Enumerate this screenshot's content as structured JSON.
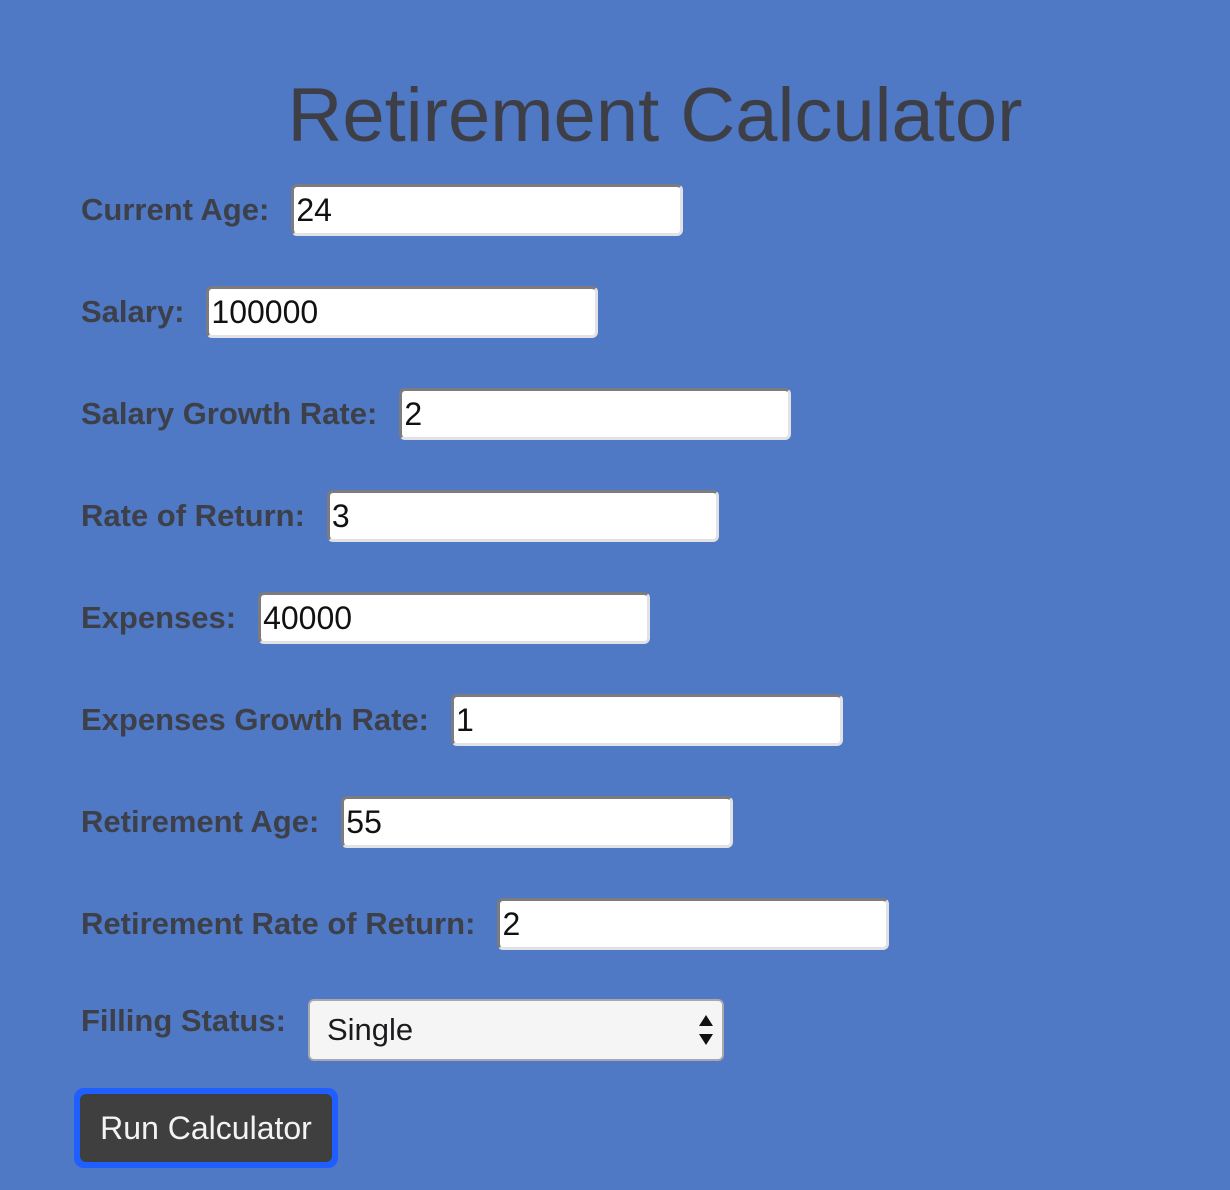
{
  "title": "Retirement Calculator",
  "form": {
    "fields": [
      {
        "label": "Current Age:",
        "value": "24"
      },
      {
        "label": "Salary:",
        "value": "100000"
      },
      {
        "label": "Salary Growth Rate:",
        "value": "2"
      },
      {
        "label": "Rate of Return:",
        "value": "3"
      },
      {
        "label": "Expenses:",
        "value": "40000"
      },
      {
        "label": "Expenses Growth Rate:",
        "value": "1"
      },
      {
        "label": "Retirement Age:",
        "value": "55"
      },
      {
        "label": "Retirement Rate of Return:",
        "value": "2"
      }
    ],
    "filing_status": {
      "label": "Filling Status:",
      "selected": "Single"
    },
    "submit_label": "Run Calculator"
  },
  "colors": {
    "background": "#4f78c5",
    "text": "#3d4049",
    "button": "#403f3f",
    "focus_ring": "#1f5fff"
  },
  "icons": {
    "select_arrows": "up-down-arrows-icon"
  }
}
